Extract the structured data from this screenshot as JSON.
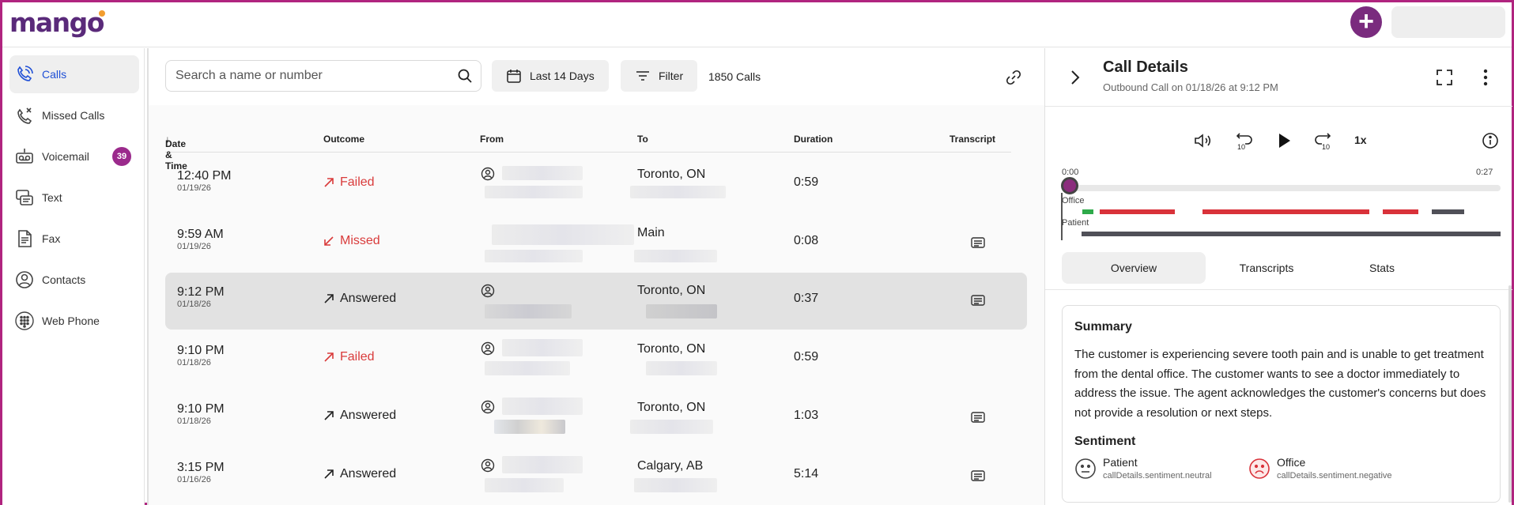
{
  "app": {
    "logo": "mango"
  },
  "sidebar": {
    "items": [
      {
        "label": "Calls",
        "icon": "calls-icon",
        "active": true
      },
      {
        "label": "Missed Calls",
        "icon": "missed-call-icon"
      },
      {
        "label": "Voicemail",
        "icon": "voicemail-icon",
        "badge": "39"
      },
      {
        "label": "Text",
        "icon": "text-icon"
      },
      {
        "label": "Fax",
        "icon": "fax-icon"
      },
      {
        "label": "Contacts",
        "icon": "contacts-icon"
      },
      {
        "label": "Web Phone",
        "icon": "dialpad-icon"
      }
    ]
  },
  "toolbar": {
    "search_placeholder": "Search a name or number",
    "date_range_label": "Last 14 Days",
    "filter_label": "Filter",
    "calls_count": "1850 Calls"
  },
  "table": {
    "columns": [
      "Date & Time",
      "Outcome",
      "From",
      "To",
      "Duration",
      "Transcript"
    ],
    "rows": [
      {
        "time": "12:40 PM",
        "date": "01/19/26",
        "outcome": "Failed",
        "outcome_type": "failed",
        "to": "Toronto, ON",
        "duration": "0:59",
        "transcript": false
      },
      {
        "time": "9:59 AM",
        "date": "01/19/26",
        "outcome": "Missed",
        "outcome_type": "missed",
        "to": "Main",
        "duration": "0:08",
        "transcript": true
      },
      {
        "time": "9:12 PM",
        "date": "01/18/26",
        "outcome": "Answered",
        "outcome_type": "answered",
        "to": "Toronto, ON",
        "duration": "0:37",
        "transcript": true,
        "selected": true
      },
      {
        "time": "9:10 PM",
        "date": "01/18/26",
        "outcome": "Failed",
        "outcome_type": "failed",
        "to": "Toronto, ON",
        "duration": "0:59",
        "transcript": false
      },
      {
        "time": "9:10 PM",
        "date": "01/18/26",
        "outcome": "Answered",
        "outcome_type": "answered",
        "to": "Toronto, ON",
        "duration": "1:03",
        "transcript": true
      },
      {
        "time": "3:15 PM",
        "date": "01/16/26",
        "outcome": "Answered",
        "outcome_type": "answered",
        "to": "Calgary, AB",
        "duration": "5:14",
        "transcript": true
      }
    ]
  },
  "details": {
    "title": "Call Details",
    "subtitle": "Outbound Call on 01/18/26 at 9:12 PM",
    "player": {
      "speed": "1x",
      "time_start": "0:00",
      "time_end": "0:27"
    },
    "lanes": {
      "office": "Office",
      "patient": "Patient"
    },
    "tabs": [
      "Overview",
      "Transcripts",
      "Stats"
    ],
    "active_tab": "Overview",
    "summary_title": "Summary",
    "summary_text": "The customer is experiencing severe tooth pain and is unable to get treatment from the dental office. The customer wants to see a doctor immediately to address the issue. The agent acknowledges the customer's concerns but does not provide a resolution or next steps.",
    "sentiment_title": "Sentiment",
    "sentiment": [
      {
        "who": "Patient",
        "value": "callDetails.sentiment.neutral",
        "icon": "neutral-face-icon"
      },
      {
        "who": "Office",
        "value": "callDetails.sentiment.negative",
        "icon": "sad-face-icon"
      }
    ]
  },
  "colors": {
    "brand": "#7a2b7e",
    "active_nav": "#1f4fd6",
    "failed": "#d93b3b",
    "office_segment": "#d9323a",
    "office_green": "#2eaa4a",
    "patient_segment": "#505058"
  }
}
